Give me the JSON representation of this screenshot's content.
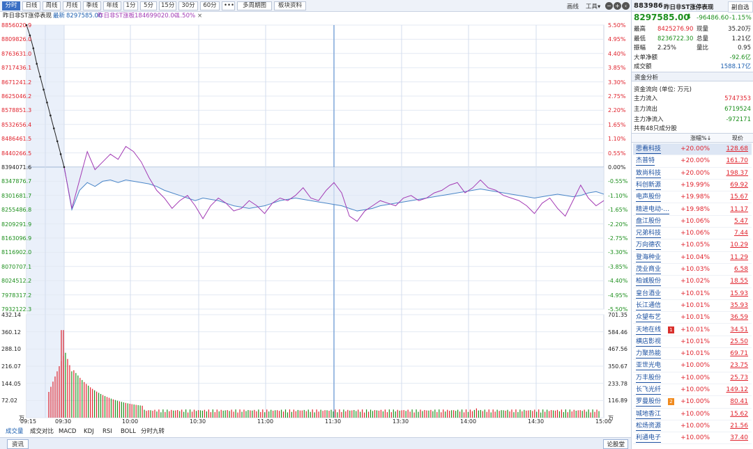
{
  "toolbar": {
    "buttons": [
      "分时",
      "日线",
      "周线",
      "月线",
      "季线",
      "年线",
      "1分",
      "5分",
      "15分",
      "30分",
      "60分",
      "•••",
      "多周期图",
      "板块资料"
    ],
    "right": [
      "画线",
      "工具▾"
    ]
  },
  "info": {
    "title": "昨日非ST涨停表现",
    "latest_label": "最新",
    "latest_value": "8297585.00",
    "prev_label": "昨日非ST涨板",
    "prev_value": "184699020.00",
    "change_pct": "-1.50%",
    "close": "×"
  },
  "axis": {
    "price_left": [
      "8856020.9",
      "8809826.0",
      "8763631.0",
      "8717436.1",
      "8671241.2",
      "8625046.2",
      "8578851.3",
      "8532656.4",
      "8486461.5",
      "8440266.5",
      "8394071.6",
      "8347876.7",
      "8301681.7",
      "8255486.8",
      "8209291.9",
      "8163096.9",
      "8116902.0",
      "8070707.1",
      "8024512.2",
      "7978317.2",
      "7932122.3"
    ],
    "pct_right": [
      "5.50%",
      "4.95%",
      "4.40%",
      "3.85%",
      "3.30%",
      "2.75%",
      "2.20%",
      "1.65%",
      "1.10%",
      "0.55%",
      "0.00%",
      "-0.55%",
      "-1.10%",
      "-1.65%",
      "-2.20%",
      "-2.75%",
      "-3.30%",
      "-3.85%",
      "-4.40%",
      "-4.95%",
      "-5.50%"
    ],
    "vol_left": [
      "432.14",
      "360.12",
      "288.10",
      "216.07",
      "144.05",
      "72.02",
      "万"
    ],
    "vol_right": [
      "701.35",
      "584.46",
      "467.56",
      "350.67",
      "233.78",
      "116.89",
      "万"
    ],
    "time": [
      "09:15",
      "09:30",
      "10:00",
      "10:30",
      "11:00",
      "11:30",
      "13:30",
      "14:00",
      "14:30",
      "15:00"
    ]
  },
  "colors": {
    "up": "#e0222c",
    "down": "#1c8f1c",
    "line_main": "#4a86c8",
    "line_avg": "#a23ab4",
    "grid": "#dbe3ef"
  },
  "bottom_tabs": [
    "成交量",
    "成交对比",
    "MACD",
    "KDJ",
    "RSI",
    "BOLL",
    "分时九转"
  ],
  "bottom_bar": {
    "left": "资讯",
    "right": "论股堂"
  },
  "right_panel": {
    "code": "883986",
    "name": "昨日非ST涨停表现",
    "tab": "副自选",
    "price": "8297585.00",
    "arrow": "⬇",
    "change": "-96486.60",
    "change_pct": "-1.15%",
    "stats": [
      {
        "l": "最高",
        "v": "8425276.90",
        "l2": "现量",
        "v2": "35.20万"
      },
      {
        "l": "最低",
        "v": "8236722.30",
        "l2": "总量",
        "v2": "1.21亿"
      },
      {
        "l": "振幅",
        "v": "2.25%",
        "l2": "量比",
        "v2": "0.95"
      }
    ],
    "big_net_label": "大单净额",
    "big_net": "-92.6亿",
    "turnover_label": "成交额",
    "turnover": "1588.17亿",
    "fund_title": "资金分析",
    "fund_unit": "资金流向 (单位: 万元)",
    "fund": [
      {
        "l": "主力流入",
        "v": "5747353"
      },
      {
        "l": "主力流出",
        "v": "6719524"
      },
      {
        "l": "主力净流入",
        "v": "-972171"
      }
    ],
    "count_text": "共有48只成分股",
    "col_pct": "涨幅%↓",
    "col_price": "现价",
    "stocks": [
      {
        "n": "思看科技",
        "p": "+20.00%",
        "v": "128.68"
      },
      {
        "n": "杰普特",
        "p": "+20.00%",
        "v": "161.70"
      },
      {
        "n": "致尚科技",
        "p": "+20.00%",
        "v": "198.37"
      },
      {
        "n": "科创新源",
        "p": "+19.99%",
        "v": "69.92"
      },
      {
        "n": "电声股份",
        "p": "+19.98%",
        "v": "15.67"
      },
      {
        "n": "精进电动-...",
        "p": "+19.98%",
        "v": "11.17"
      },
      {
        "n": "盘江股份",
        "p": "+10.06%",
        "v": "5.47"
      },
      {
        "n": "兄弟科技",
        "p": "+10.06%",
        "v": "7.44"
      },
      {
        "n": "万向德农",
        "p": "+10.05%",
        "v": "10.29"
      },
      {
        "n": "登海种业",
        "p": "+10.04%",
        "v": "11.29"
      },
      {
        "n": "茂业商业",
        "p": "+10.03%",
        "v": "6.58"
      },
      {
        "n": "柏诚股份",
        "p": "+10.02%",
        "v": "18.55"
      },
      {
        "n": "皇台酒业",
        "p": "+10.01%",
        "v": "15.93"
      },
      {
        "n": "长江通信",
        "p": "+10.01%",
        "v": "35.93"
      },
      {
        "n": "众望布艺",
        "p": "+10.01%",
        "v": "36.59"
      },
      {
        "n": "天地在线",
        "p": "+10.01%",
        "v": "34.51",
        "tag": "1"
      },
      {
        "n": "横店影视",
        "p": "+10.01%",
        "v": "25.50"
      },
      {
        "n": "力聚热能",
        "p": "+10.01%",
        "v": "69.71"
      },
      {
        "n": "亚世光电",
        "p": "+10.00%",
        "v": "23.75"
      },
      {
        "n": "万丰股份",
        "p": "+10.00%",
        "v": "25.73"
      },
      {
        "n": "长飞光纤",
        "p": "+10.00%",
        "v": "149.12"
      },
      {
        "n": "罗曼股份",
        "p": "+10.00%",
        "v": "80.41",
        "tag": "2"
      },
      {
        "n": "城地香江",
        "p": "+10.00%",
        "v": "15.62"
      },
      {
        "n": "松炀资源",
        "p": "+10.00%",
        "v": "21.56"
      },
      {
        "n": "利通电子",
        "p": "+10.00%",
        "v": "37.40"
      }
    ]
  },
  "chart_data": {
    "type": "line",
    "series": [
      {
        "values": [
          0.0,
          -1.65,
          -0.9,
          -0.6,
          -0.75,
          -0.55,
          -0.5,
          -0.6,
          -0.5,
          -0.55,
          -0.6,
          -0.65,
          -0.75,
          -0.9,
          -1.0,
          -1.1,
          -1.2,
          -1.3,
          -1.2,
          -1.25,
          -1.3,
          -1.4,
          -1.5,
          -1.55,
          -1.6,
          -1.55,
          -1.5,
          -1.4,
          -1.3,
          -1.25,
          -1.2,
          -1.25,
          -1.3,
          -1.35,
          -1.4,
          -1.45,
          -1.5,
          -1.6,
          -1.7,
          -1.65,
          -1.6,
          -1.5,
          -1.45,
          -1.4,
          -1.35,
          -1.3,
          -1.25,
          -1.2,
          -1.15,
          -1.1,
          -1.05,
          -1.0,
          -0.95,
          -0.9,
          -0.85,
          -0.9,
          -0.95,
          -1.0,
          -1.05,
          -1.1,
          -1.15,
          -1.2,
          -1.15,
          -1.1,
          -1.05,
          -1.1,
          -1.15,
          -1.1,
          -1.0,
          -0.95,
          -1.05
        ]
      },
      {
        "values": [
          0.0,
          -1.6,
          -0.5,
          0.6,
          -0.1,
          0.2,
          0.5,
          0.3,
          0.8,
          0.6,
          0.2,
          -0.4,
          -0.9,
          -1.2,
          -1.6,
          -1.3,
          -1.1,
          -1.5,
          -2.0,
          -1.5,
          -1.2,
          -1.4,
          -1.7,
          -1.6,
          -1.3,
          -1.5,
          -1.8,
          -1.4,
          -1.2,
          -1.3,
          -1.1,
          -0.8,
          -1.2,
          -1.3,
          -0.9,
          -0.6,
          -1.0,
          -1.9,
          -2.1,
          -1.7,
          -1.5,
          -1.3,
          -1.4,
          -1.5,
          -1.2,
          -1.1,
          -1.3,
          -1.2,
          -1.0,
          -0.9,
          -0.7,
          -0.6,
          -1.0,
          -0.8,
          -0.5,
          -0.8,
          -0.9,
          -1.1,
          -1.2,
          -1.3,
          -1.5,
          -1.8,
          -1.4,
          -1.2,
          -1.6,
          -1.9,
          -1.3,
          -0.7,
          -1.2,
          -1.5,
          -1.3
        ]
      }
    ],
    "pre_open": [
      5.5,
      5.1,
      4.6,
      4.0,
      3.5,
      3.0,
      2.5,
      2.0,
      1.5,
      1.0,
      0.5,
      0.0
    ],
    "ylim": [
      -5.5,
      5.5
    ],
    "vol_ylim": [
      0,
      432.14
    ]
  }
}
